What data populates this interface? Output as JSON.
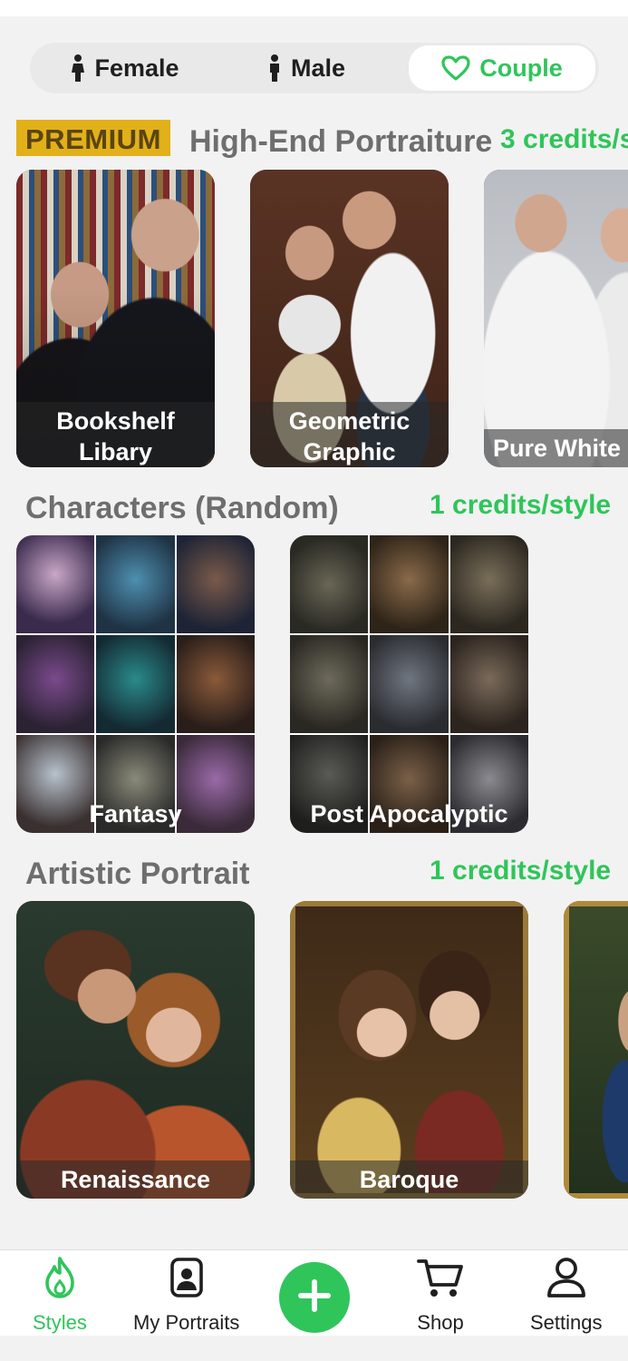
{
  "gender_tabs": [
    {
      "label": "Female",
      "selected": false
    },
    {
      "label": "Male",
      "selected": false
    },
    {
      "label": "Couple",
      "selected": true
    }
  ],
  "sections": [
    {
      "badge": "PREMIUM",
      "title": "High-End Portraiture",
      "credits": "3 credits/s",
      "cards": [
        {
          "label": "Bookshelf Libary"
        },
        {
          "label": "Geometric Graphic"
        },
        {
          "label": "Pure White"
        }
      ]
    },
    {
      "title": "Characters (Random)",
      "credits": "1 credits/style",
      "cards": [
        {
          "label": "Fantasy"
        },
        {
          "label": "Post Apocalyptic"
        }
      ]
    },
    {
      "title": "Artistic Portrait",
      "credits": "1 credits/style",
      "cards": [
        {
          "label": "Renaissance"
        },
        {
          "label": "Baroque"
        },
        {
          "label": ""
        }
      ]
    }
  ],
  "bottom_nav": [
    {
      "label": "Styles",
      "icon": "flame-icon",
      "active": true
    },
    {
      "label": "My Portraits",
      "icon": "portrait-icon",
      "active": false
    },
    {
      "label": "",
      "icon": "plus-icon",
      "active": false
    },
    {
      "label": "Shop",
      "icon": "cart-icon",
      "active": false
    },
    {
      "label": "Settings",
      "icon": "user-icon",
      "active": false
    }
  ],
  "colors": {
    "accent_green": "#2fc55a",
    "premium_gold": "#e2b019",
    "background": "#f2f2f2"
  }
}
